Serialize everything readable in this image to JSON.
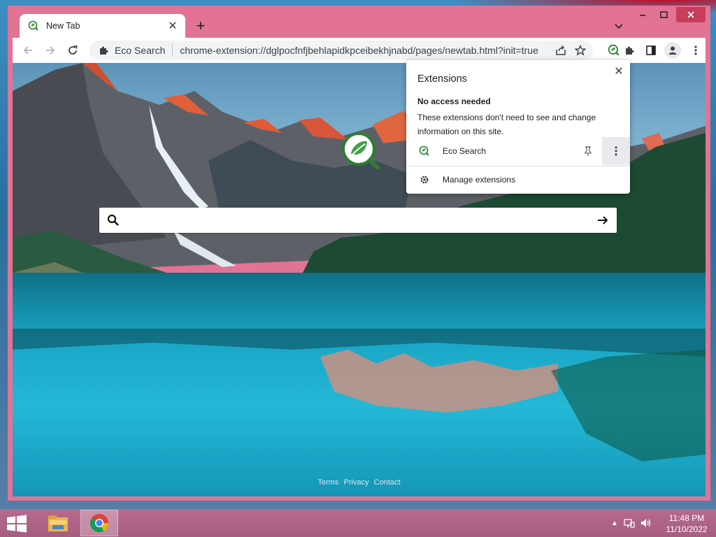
{
  "browser": {
    "tab": {
      "title": "New Tab"
    },
    "omnibox": {
      "extension_name": "Eco Search",
      "url": "chrome-extension://dglpocfnfjbehlapidkpceibekhjnabd/pages/newtab.html?init=true"
    }
  },
  "page": {
    "search": {
      "placeholder": ""
    },
    "footer": {
      "terms": "Terms",
      "privacy": "Privacy",
      "contact": "Contact"
    }
  },
  "extensions_popup": {
    "title": "Extensions",
    "section_heading": "No access needed",
    "section_description": "These extensions don't need to see and change information on this site.",
    "items": [
      {
        "label": "Eco Search"
      }
    ],
    "manage_label": "Manage extensions"
  },
  "taskbar": {
    "time": "11:48 PM",
    "date": "11/10/2022"
  },
  "icons": {
    "accent_green": "#2e7d32",
    "window_frame": "#e37394",
    "close_red": "#c83d5a"
  }
}
